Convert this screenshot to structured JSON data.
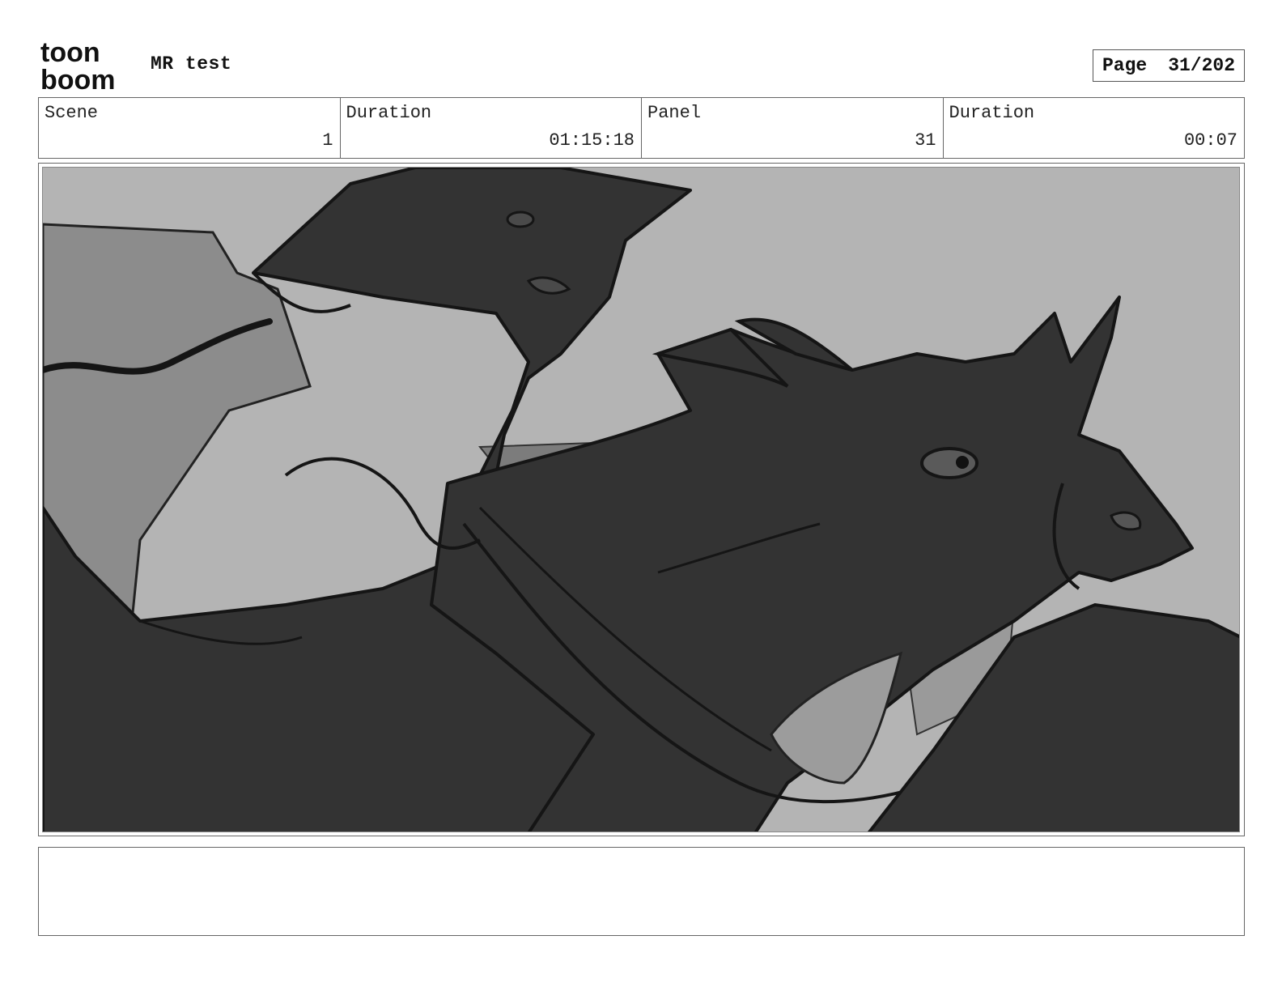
{
  "header": {
    "logo": {
      "line1": "toon",
      "line2": "boom",
      "icon": "toon-boom-logo"
    },
    "project_title": "MR test",
    "page": {
      "label": "Page",
      "value": "31/202"
    }
  },
  "info": [
    {
      "label": "Scene",
      "value": "1"
    },
    {
      "label": "Duration",
      "value": "01:15:18"
    },
    {
      "label": "Panel",
      "value": "31"
    },
    {
      "label": "Duration",
      "value": "00:07"
    }
  ],
  "panel": {
    "image": "rough-sketch-rider-on-horse",
    "colors": {
      "background": "#b4b4b4",
      "figure": "#333333",
      "line": "#151515",
      "mid": "#8a8a8a"
    }
  },
  "notes": {
    "text": ""
  }
}
